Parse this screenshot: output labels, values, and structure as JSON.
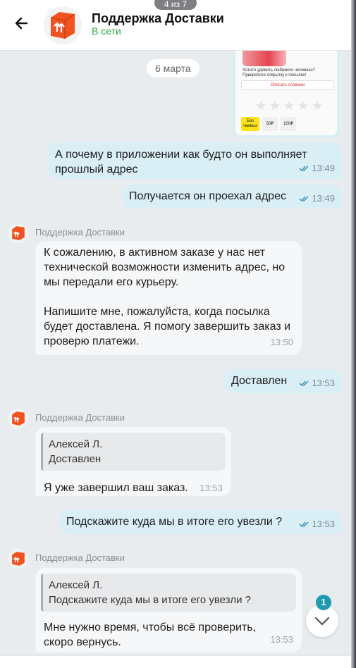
{
  "header": {
    "title": "Поддержка Доставки",
    "status": "В сети",
    "page_counter": "4 из 7"
  },
  "date_divider": "6 марта",
  "image_message": {
    "promo_text": "Хотите удивить любимого человека? Прикрепите открытку к посылке!",
    "promo_button": "Описать словами",
    "tips": [
      "Без чаевых",
      "50₽",
      "100₽"
    ]
  },
  "messages": [
    {
      "direction": "out",
      "text": "А почему в приложении как будто он выполняет прошлый адрес",
      "time": "13:49"
    },
    {
      "direction": "out",
      "text": "Получается он проехал адрес",
      "time": "13:49"
    },
    {
      "direction": "in",
      "sender": "Поддержка Доставки",
      "text": "К сожалению, в активном заказе у нас нет технической возможности изменить адрес, но мы передали его курьеру.\n\nНапишите мне, пожалуйста, когда посылка будет доставлена. Я помогу завершить заказ и проверю платежи.",
      "time": "13:50"
    },
    {
      "direction": "out",
      "text": "Доставлен",
      "time": "13:53"
    },
    {
      "direction": "in",
      "sender": "Поддержка Доставки",
      "quote_author": "Алексей Л.",
      "quote_text": "Доставлен",
      "text": "Я уже завершил ваш заказ.",
      "time": "13:53"
    },
    {
      "direction": "out",
      "text": "Подскажите куда мы в итоге его увезли ?",
      "time": "13:53"
    },
    {
      "direction": "in",
      "sender": "Поддержка Доставки",
      "quote_author": "Алексей Л.",
      "quote_text": "Подскажите куда мы в итоге его увезли ?",
      "text": "Мне нужно время, чтобы всё проверить, скоро вернусь.",
      "time": "13:53"
    }
  ],
  "unread_count": "1",
  "colors": {
    "outgoing_bubble": "#d9eef5",
    "incoming_bubble": "#f6f7f8",
    "online_status": "#2eaa4a",
    "brand_orange": "#f0531f",
    "read_check": "#3a8fb7",
    "badge": "#1f9ab3"
  },
  "icons": [
    "back-arrow-icon",
    "delivery-box-logo-icon",
    "double-check-icon",
    "chevron-down-icon"
  ]
}
